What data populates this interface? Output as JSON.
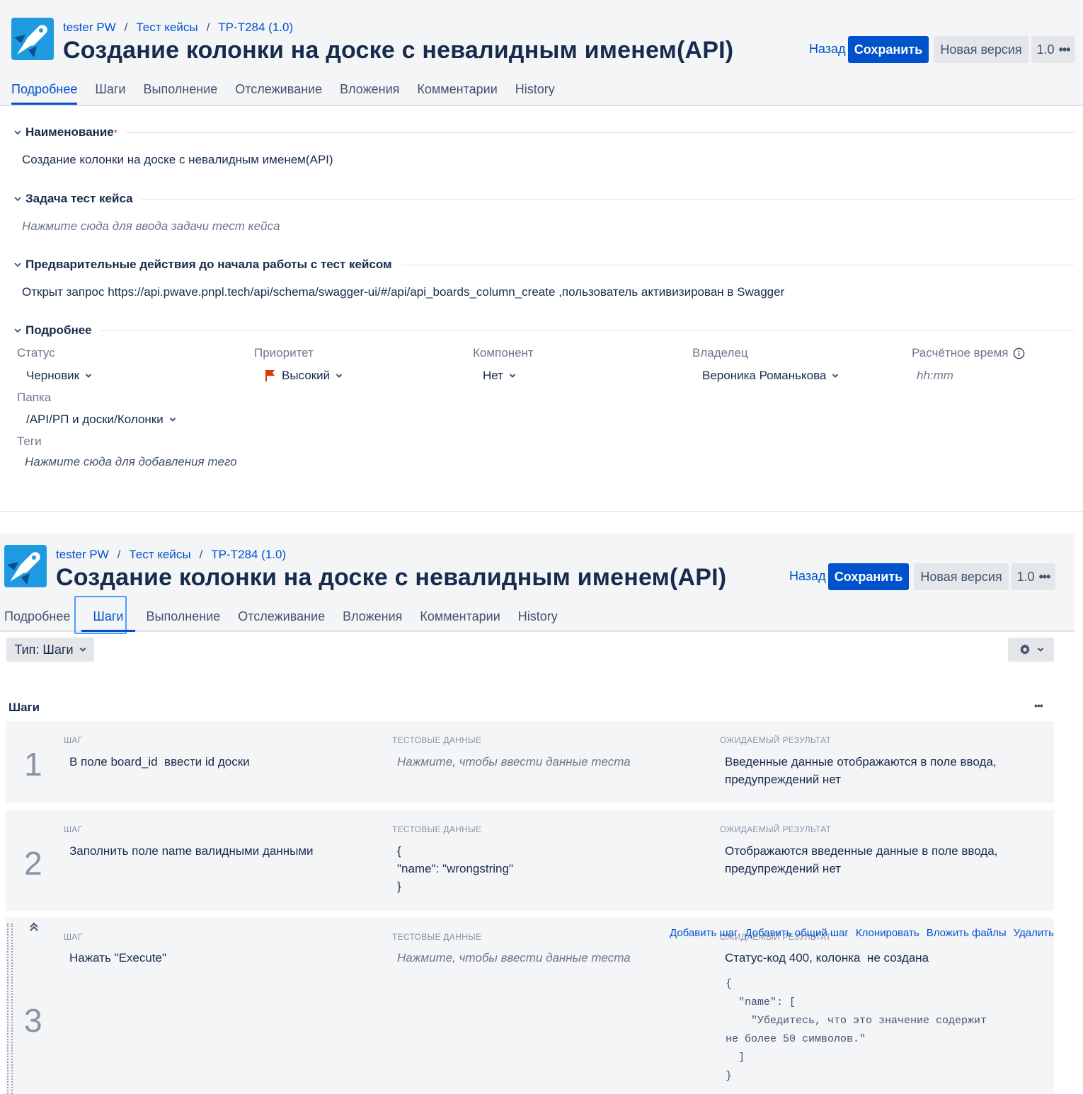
{
  "breadcrumb": {
    "project": "tester PW",
    "section": "Тест кейсы",
    "key": "TP-T284 (1.0)"
  },
  "title": "Создание колонки на доске с невалидным именем(API)",
  "buttons": {
    "back": "Назад",
    "save": "Сохранить",
    "new_version": "Новая версия",
    "version": "1.0"
  },
  "tabs": [
    "Подробнее",
    "Шаги",
    "Выполнение",
    "Отслеживание",
    "Вложения",
    "Комментарии",
    "History"
  ],
  "details": {
    "name_label": "Наименование",
    "required_mark": "*",
    "name_value": "Создание колонки на доске с невалидным именем(API)",
    "task_label": "Задача тест кейса",
    "task_placeholder": "Нажмите сюда для ввода задачи тест кейса",
    "precond_label": "Предварительные действия до начала работы с тест кейсом",
    "precond_value": "Открыт запрос https://api.pwave.pnpl.tech/api/schema/swagger-ui/#/api/api_boards_column_create  ,пользователь активизирован в Swagger",
    "more_label": "Подробнее",
    "status_label": "Статус",
    "status_value": "Черновик",
    "priority_label": "Приоритет",
    "priority_value": "Высокий",
    "component_label": "Компонент",
    "component_value": "Нет",
    "owner_label": "Владелец",
    "owner_value": "Вероника Романькова",
    "estimate_label": "Расчётное время",
    "estimate_placeholder": "hh:mm",
    "folder_label": "Папка",
    "folder_value": "/API/РП и доски/Колонки",
    "tags_label": "Теги",
    "tags_placeholder": "Нажмите сюда для добавления тего"
  },
  "steps_view": {
    "type_dropdown": "Тип: Шаги",
    "section_title": "Шаги",
    "col_step": "ШАГ",
    "col_data": "ТЕСТОВЫЕ ДАННЫЕ",
    "col_result": "ОЖИДАЕМЫЙ РЕЗУЛЬТАТ",
    "actions": [
      "Добавить шаг",
      "Добавить общий шаг",
      "Клонировать",
      "Вложить файлы",
      "Удалить"
    ],
    "steps": [
      {
        "num": "1",
        "step": "В поле board_id  ввести id доски",
        "data": "Нажмите, чтобы ввести данные теста",
        "result": "Введенные данные отображаются в поле ввода,\nпредупреждений нет"
      },
      {
        "num": "2",
        "step": "Заполнить поле name валидными данными",
        "data": "{\n\"name\": \"wrongstring\"\n}",
        "result": "Отображаются введенные данные в поле ввода,\nпредупреждений нет"
      },
      {
        "num": "3",
        "step": "Нажать \"Execute\"",
        "data": "Нажмите, чтобы ввести данные теста",
        "result": "Статус-код 400, колонка  не создана",
        "result_code": "{\n  \"name\": [\n    \"Убедитесь, что это значение содержит\nне более 50 символов.\"\n  ]\n}"
      }
    ]
  },
  "colors": {
    "accent": "#0052cc",
    "flag": "#de350b"
  }
}
